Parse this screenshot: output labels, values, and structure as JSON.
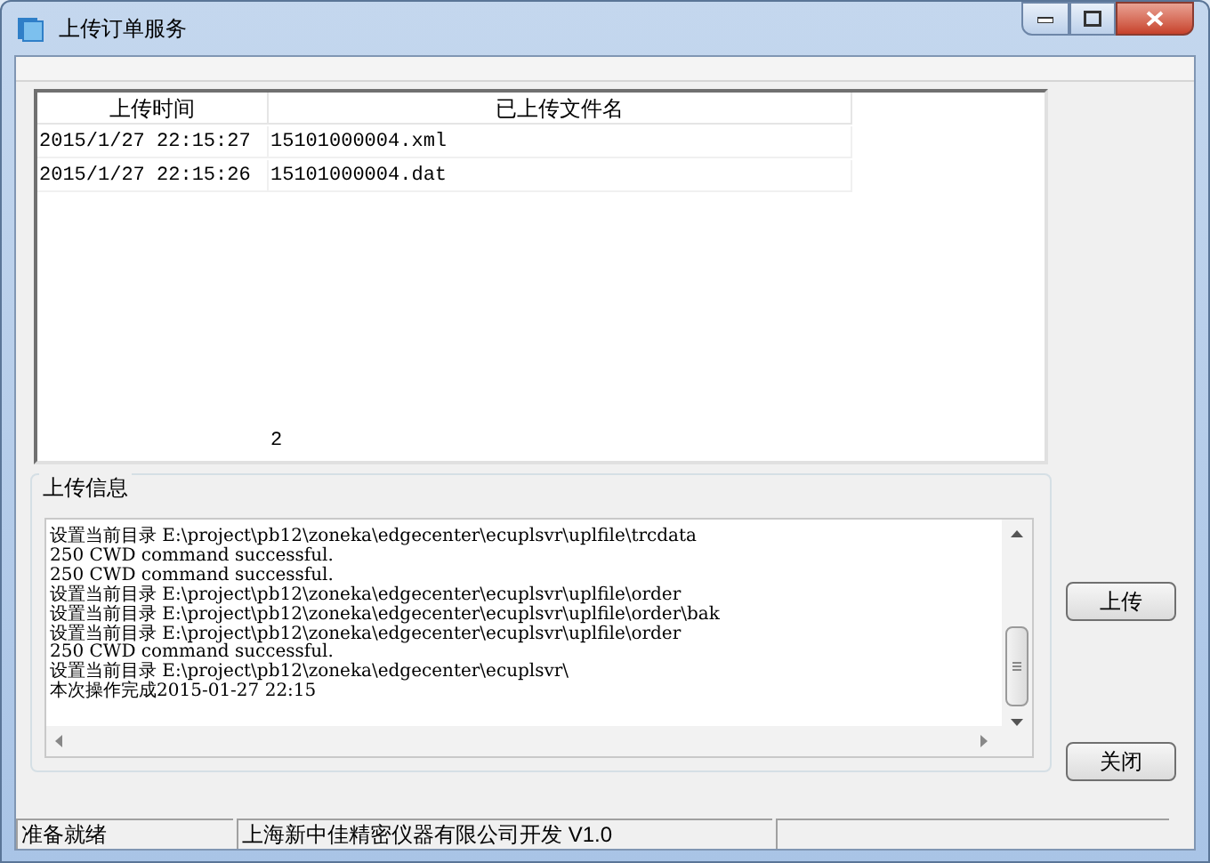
{
  "window": {
    "title": "上传订单服务"
  },
  "table": {
    "columns": [
      "上传时间",
      "已上传文件名"
    ],
    "rows": [
      [
        "2015/1/27 22:15:27",
        "15101000004.xml"
      ],
      [
        "2015/1/27 22:15:26",
        "15101000004.dat"
      ]
    ],
    "footer": "2"
  },
  "log": {
    "title": "上传信息",
    "lines": [
      "设置当前目录 E:\\project\\pb12\\zoneka\\edgecenter\\ecuplsvr\\uplfile\\trcdata",
      "250 CWD command successful.",
      "250 CWD command successful.",
      "设置当前目录 E:\\project\\pb12\\zoneka\\edgecenter\\ecuplsvr\\uplfile\\order",
      "设置当前目录 E:\\project\\pb12\\zoneka\\edgecenter\\ecuplsvr\\uplfile\\order\\bak",
      "设置当前目录 E:\\project\\pb12\\zoneka\\edgecenter\\ecuplsvr\\uplfile\\order",
      "250 CWD command successful.",
      "设置当前目录 E:\\project\\pb12\\zoneka\\edgecenter\\ecuplsvr\\",
      "本次操作完成2015-01-27 22:15"
    ]
  },
  "buttons": [
    "上传",
    "关闭"
  ],
  "status_bar": [
    "准备就绪",
    "上海新中佳精密仪器有限公司开发 V1.0"
  ]
}
